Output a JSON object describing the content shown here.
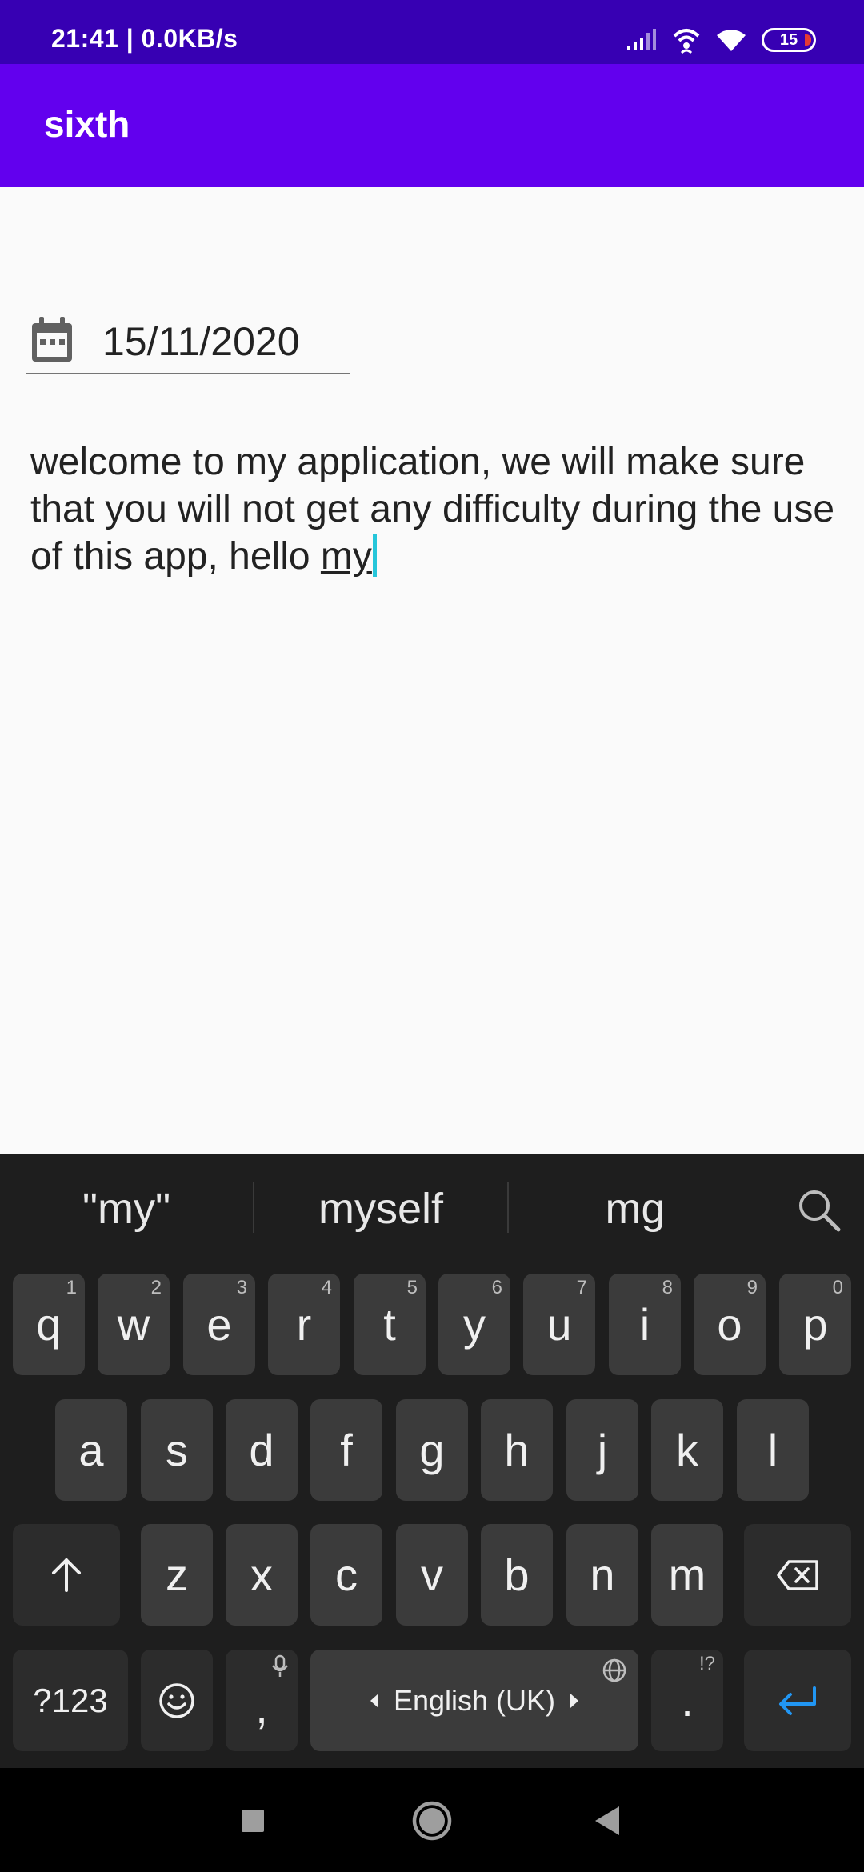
{
  "status_bar": {
    "time": "21:41 | 0.0KB/s",
    "battery": "15"
  },
  "app_bar": {
    "title": "sixth"
  },
  "date_field": {
    "value": "15/11/2020"
  },
  "body": {
    "text_before": "welcome to my application, we will make sure that you will not get any difficulty during the use of this app, hello ",
    "text_composing": "my"
  },
  "keyboard": {
    "suggestions": [
      "\"my\"",
      "myself",
      "mg"
    ],
    "row1": [
      {
        "key": "q",
        "hint": "1"
      },
      {
        "key": "w",
        "hint": "2"
      },
      {
        "key": "e",
        "hint": "3"
      },
      {
        "key": "r",
        "hint": "4"
      },
      {
        "key": "t",
        "hint": "5"
      },
      {
        "key": "y",
        "hint": "6"
      },
      {
        "key": "u",
        "hint": "7"
      },
      {
        "key": "i",
        "hint": "8"
      },
      {
        "key": "o",
        "hint": "9"
      },
      {
        "key": "p",
        "hint": "0"
      }
    ],
    "row2": [
      "a",
      "s",
      "d",
      "f",
      "g",
      "h",
      "j",
      "k",
      "l"
    ],
    "row3": [
      "z",
      "x",
      "c",
      "v",
      "b",
      "n",
      "m"
    ],
    "symbols_key": "?123",
    "comma_key": ",",
    "space_label": "English (UK)",
    "period_key": ".",
    "period_hint": "!?"
  },
  "icons": {
    "calendar": "calendar-icon",
    "shift": "shift-icon",
    "backspace": "backspace-icon",
    "emoji": "emoji-icon",
    "mic": "mic-icon",
    "globe": "globe-icon",
    "enter": "enter-icon",
    "search": "search-icon",
    "recents": "recents-icon",
    "home": "home-icon",
    "back": "back-icon"
  },
  "colors": {
    "status_bar": "#3700b3",
    "app_bar": "#6200ee",
    "cursor": "#26c6da",
    "keyboard": "#1e1e1e",
    "enter_key": "#2196f3"
  }
}
